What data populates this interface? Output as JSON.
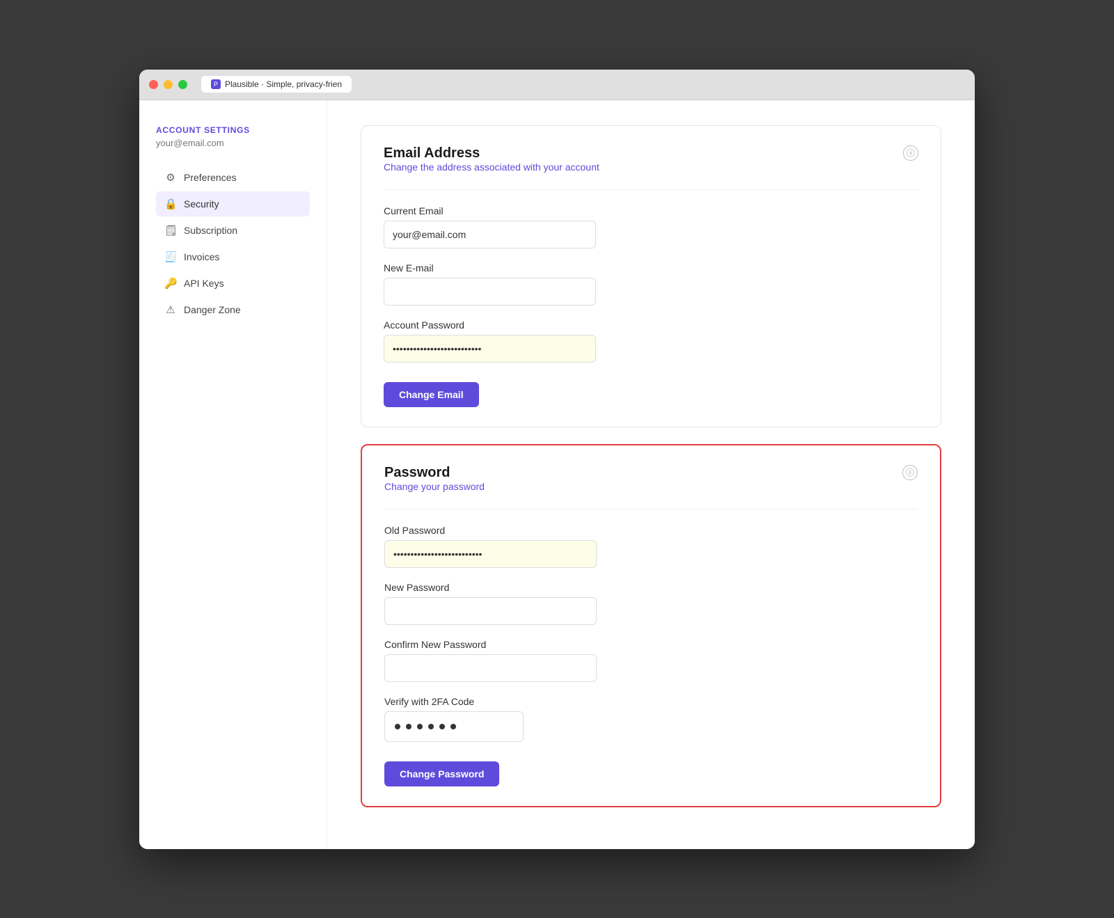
{
  "window": {
    "title": "Plausible · Simple, privacy-frien"
  },
  "sidebar": {
    "section_title": "ACCOUNT SETTINGS",
    "user_email": "your@email.com",
    "nav_items": [
      {
        "id": "preferences",
        "label": "Preferences",
        "icon": "⚙",
        "active": false
      },
      {
        "id": "security",
        "label": "Security",
        "icon": "🔒",
        "active": true
      },
      {
        "id": "subscription",
        "label": "Subscription",
        "icon": "🗒",
        "active": false
      },
      {
        "id": "invoices",
        "label": "Invoices",
        "icon": "🧾",
        "active": false
      },
      {
        "id": "api-keys",
        "label": "API Keys",
        "icon": "🔑",
        "active": false
      },
      {
        "id": "danger-zone",
        "label": "Danger Zone",
        "icon": "⚠",
        "active": false
      }
    ]
  },
  "email_card": {
    "title": "Email Address",
    "subtitle": "Change the address associated with your account",
    "current_email_label": "Current Email",
    "current_email_value": "your@email.com",
    "new_email_label": "New E-mail",
    "new_email_placeholder": "",
    "account_password_label": "Account Password",
    "account_password_value": "••••••••••••••••••••••••••••••••••••••••••",
    "button_label": "Change Email"
  },
  "password_card": {
    "title": "Password",
    "subtitle": "Change your password",
    "old_password_label": "Old Password",
    "old_password_value": "••••••••••••••••••••••••••••••••••••••••••",
    "new_password_label": "New Password",
    "new_password_placeholder": "",
    "confirm_password_label": "Confirm New Password",
    "confirm_password_placeholder": "",
    "twofa_label": "Verify with 2FA Code",
    "twofa_dots": [
      "•",
      "•",
      "•",
      "•",
      "•",
      "•"
    ],
    "button_label": "Change Password"
  },
  "icons": {
    "info": "ⓘ",
    "lock": "🔒",
    "gear": "⚙",
    "card": "🗒",
    "invoice": "🧾",
    "key": "🔑",
    "warning": "⚠"
  }
}
